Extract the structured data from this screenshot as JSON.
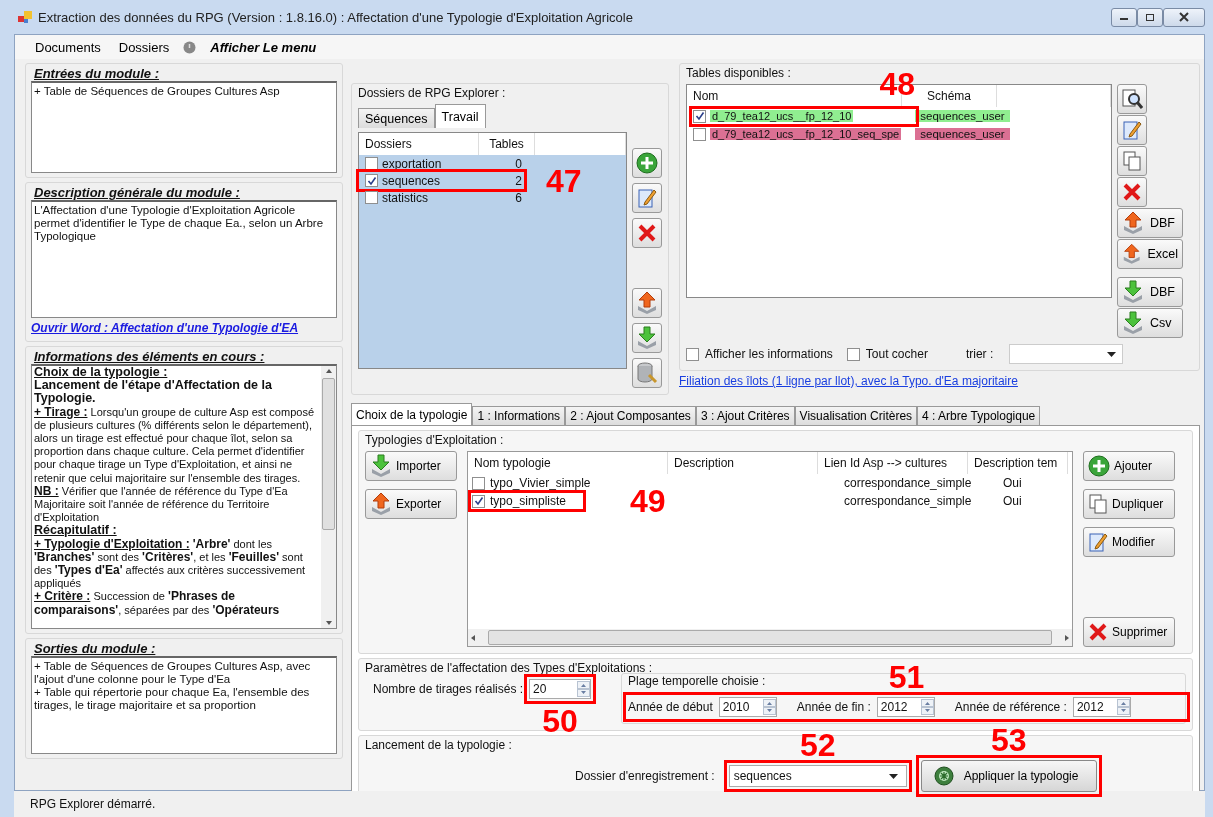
{
  "window": {
    "title": "Extraction des données du RPG (Version : 1.8.16.0) : Affectation d'une Typologie d'Exploitation Agricole"
  },
  "menu": [
    {
      "kind": "plain",
      "label": "Documents"
    },
    {
      "kind": "plain",
      "label": "Dossiers"
    },
    {
      "kind": "help",
      "label": "Afficher Le menu"
    }
  ],
  "module_inputs": {
    "title": "Entrées du module :",
    "lines": [
      "+ Table de Séquences de Groupes Cultures Asp"
    ]
  },
  "module_description": {
    "title": "Description générale du module :",
    "lines": [
      "L'Affectation d'une Typologie d'Exploitation Agricole permet d'identifier le Type de chaque Ea., selon un Arbre Typologique"
    ],
    "link": "Ouvrir Word : Affectation d'une Typologie d'EA"
  },
  "current_info": {
    "title": "Informations des éléments en cours :",
    "items": [
      {
        "kind": "heading",
        "text": "**Choix de la typologie :**"
      },
      {
        "kind": "bold",
        "text": "**Lancement de l'étape d'Affectation de la Typologie.**"
      },
      {
        "kind": "paragraph",
        "lead": "+ Tirage :",
        "text": "Lorsqu'un groupe de culture Asp est composé de plusieurs cultures (% différents selon le département), alors un tirage est effectué pour chaque îlot, selon sa proportion dans chaque culture. Cela permet d'identifier pour chaque tirage un Type d'Exploitation, et ainsi ne retenir que celui majoritaire sur l'ensemble des tirages."
      },
      {
        "kind": "paragraph",
        "lead": "NB :",
        "text": "Vérifier que l'année de référence du Type d'Ea Majoritaire soit l'année de référence du Territoire d'Exploitation"
      },
      {
        "kind": "heading",
        "text": "**Récapitulatif :**"
      },
      {
        "kind": "paragraph",
        "lead": "+ Typologie d'Exploitation :",
        "text": "**'Arbre'** dont les **'Branches'** sont des **'Critères'**, et les **'Feuilles'** sont des **'Types d'Ea'** affectés aux critères successivement appliqués"
      },
      {
        "kind": "paragraph",
        "lead": "+ Critère :",
        "text": "Succession de **'Phrases de comparaisons'**, séparées par des **'Opérateurs**"
      }
    ]
  },
  "module_outputs": {
    "title": "Sorties du module :",
    "lines": [
      "+ Table de Séquences de Groupes Cultures Asp, avec l'ajout d'une colonne pour le Type d'Ea",
      "+ Table qui répertorie pour chaque Ea, l'ensemble des tirages, le tirage majoritaire et sa proportion"
    ]
  },
  "rpg_folders": {
    "title": "Dossiers de RPG Explorer :",
    "tabs": [
      {
        "label": "Séquences",
        "selected": false
      },
      {
        "label": "Travail",
        "selected": true
      }
    ],
    "columns": [
      "Dossiers",
      "Tables"
    ],
    "rows": [
      {
        "name": "exportation",
        "tables": "0",
        "checked": false
      },
      {
        "name": "sequences",
        "tables": "2",
        "checked": true,
        "callout": {
          "number": "47"
        }
      },
      {
        "name": "statistics",
        "tables": "6",
        "checked": false
      }
    ]
  },
  "available_tables": {
    "title": "Tables disponibles :",
    "columns": [
      "Nom",
      "Schéma"
    ],
    "rows": [
      {
        "name": "d_79_tea12_ucs__fp_12_10",
        "schema": "sequences_user",
        "checked": true,
        "color": "#90ee90",
        "callout": {
          "number": "48"
        }
      },
      {
        "name": "d_79_tea12_ucs__fp_12_10_seq_spe",
        "schema": "sequences_user",
        "checked": false,
        "color": "#db7093"
      }
    ],
    "side_buttons": [
      {
        "label": "DBF"
      },
      {
        "label": "Excel"
      },
      {
        "label": "DBF"
      },
      {
        "label": "Csv"
      }
    ],
    "show_info": {
      "label": "Afficher les informations",
      "checked": false
    },
    "check_all": {
      "label": "Tout cocher",
      "checked": false
    },
    "sort": {
      "label": "trier :"
    },
    "link": "Filiation des îlots (1 ligne par llot), avec la Typo. d'Ea majoritaire"
  },
  "typology_tabs": [
    {
      "label": "Choix de la typologie",
      "selected": true
    },
    {
      "label": "1 : Informations",
      "selected": false
    },
    {
      "label": "2 : Ajout Composantes",
      "selected": false
    },
    {
      "label": "3 : Ajout Critères",
      "selected": false
    },
    {
      "label": "Visualisation Critères",
      "selected": false
    },
    {
      "label": "4 : Arbre Typologique",
      "selected": false
    }
  ],
  "typologies": {
    "title": "Typologies d'Exploitation :",
    "left_buttons": [
      {
        "label": "Importer"
      },
      {
        "label": "Exporter"
      }
    ],
    "columns": [
      "Nom typologie",
      "Description",
      "Lien Id Asp --> cultures",
      "Description tem"
    ],
    "rows": [
      {
        "name": "typo_Vivier_simple",
        "link": "correspondance_simple",
        "temporal": "Oui",
        "checked": false
      },
      {
        "name": "typo_simpliste",
        "link": "correspondance_simple",
        "temporal": "Oui",
        "checked": true,
        "callout": {
          "number": "49"
        }
      }
    ],
    "right_buttons": [
      {
        "label": "Ajouter"
      },
      {
        "label": "Dupliquer"
      },
      {
        "label": "Modifier"
      },
      {
        "label": "Supprimer"
      }
    ]
  },
  "parameters": {
    "title": "Paramètres de l'affectation des Types d'Exploitations :",
    "draws": {
      "label": "Nombre de tirages réalisés :",
      "value": "20",
      "callout": {
        "number": "50"
      }
    },
    "period": {
      "title": "Plage temporelle choisie :",
      "callout": {
        "number": "51"
      },
      "fields": [
        {
          "label": "Année de début",
          "value": "2010"
        },
        {
          "label": "Année de fin :",
          "value": "2012"
        },
        {
          "label": "Année de référence :",
          "value": "2012"
        }
      ]
    }
  },
  "launch": {
    "title": "Lancement de la typologie :",
    "folder": {
      "label": "Dossier d'enregistrement :",
      "value": "sequences",
      "callout": {
        "number": "52"
      }
    },
    "apply_button": {
      "label": "Appliquer la typologie",
      "callout": {
        "number": "53"
      }
    }
  },
  "status_bar": {
    "text": "RPG Explorer démarré."
  }
}
